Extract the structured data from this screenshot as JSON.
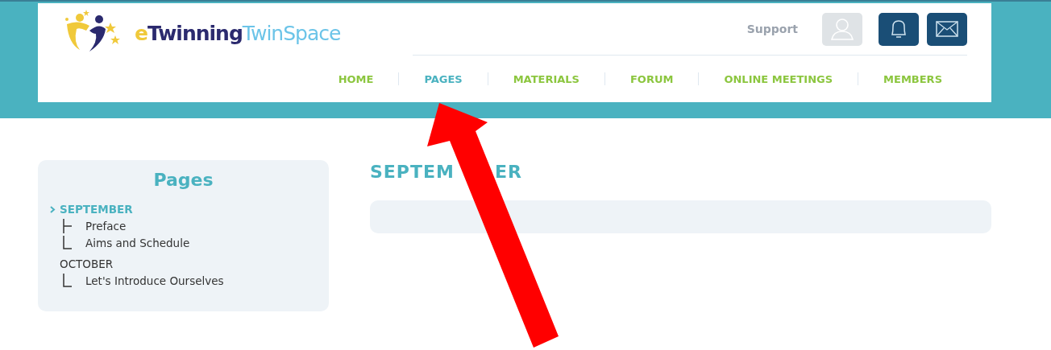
{
  "header": {
    "logo_parts": [
      "e",
      "Twinning",
      "TwinSpace"
    ],
    "support_link": "Support",
    "nav": [
      {
        "label": "HOME",
        "selected": false
      },
      {
        "label": "PAGES",
        "selected": true
      },
      {
        "label": "MATERIALS",
        "selected": false
      },
      {
        "label": "FORUM",
        "selected": false
      },
      {
        "label": "ONLINE MEETINGS",
        "selected": false
      },
      {
        "label": "MEMBERS",
        "selected": false
      }
    ]
  },
  "sidebar": {
    "title": "Pages",
    "items": [
      {
        "label": "SEPTEMBER",
        "selected": true,
        "children": [
          {
            "label": "Preface"
          },
          {
            "label": "Aims and Schedule"
          }
        ]
      },
      {
        "label": "OCTOBER",
        "selected": false,
        "children": [
          {
            "label": "Let's Introduce Ourselves"
          }
        ]
      }
    ]
  },
  "main": {
    "title_parts": [
      "SEPTEM",
      "ER"
    ]
  }
}
